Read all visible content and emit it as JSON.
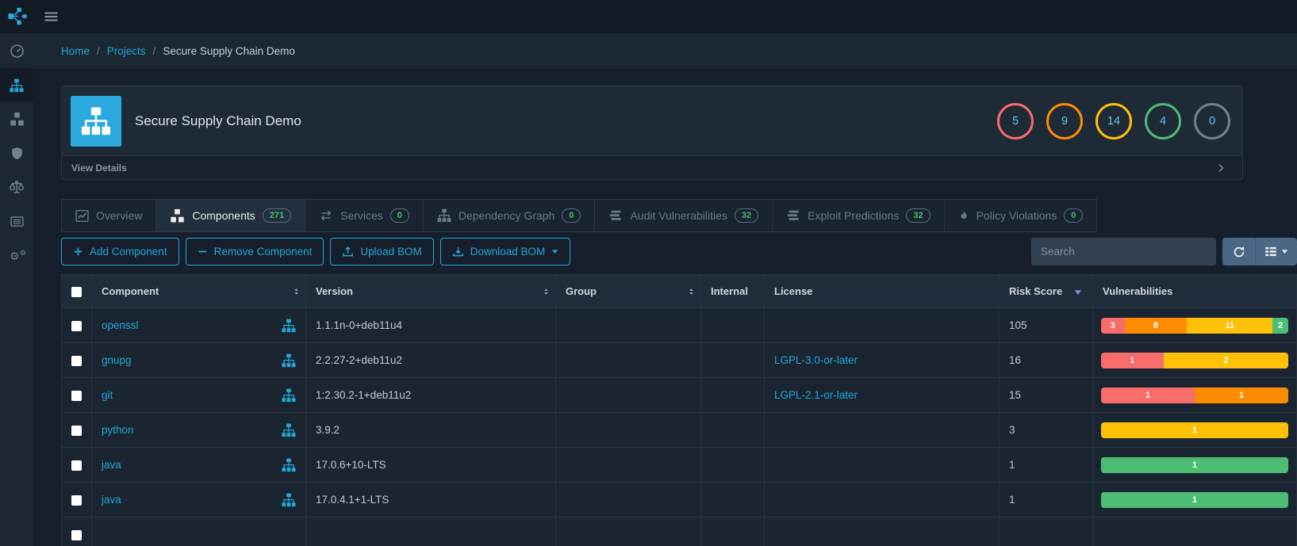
{
  "colors": {
    "accent_blue": "#20a8d8",
    "critical": "#f86c6b",
    "high": "#fd8c00",
    "medium": "#ffc107",
    "low": "#4dbd74",
    "unassigned": "#73818f"
  },
  "topbar": {
    "logo_icon": "dependency-track-logo",
    "menu_icon": "hamburger-icon"
  },
  "breadcrumb": {
    "items": [
      {
        "label": "Home",
        "link": true
      },
      {
        "label": "Projects",
        "link": true
      },
      {
        "label": "Secure Supply Chain Demo",
        "link": false
      }
    ],
    "separator": "/"
  },
  "sidebar": {
    "items": [
      {
        "name": "dashboard",
        "icon": "speedometer-icon",
        "active": false
      },
      {
        "name": "projects",
        "icon": "sitemap-icon",
        "active": true
      },
      {
        "name": "components",
        "icon": "cubes-icon",
        "active": false
      },
      {
        "name": "vulnerabilities",
        "icon": "shield-icon",
        "active": false
      },
      {
        "name": "licenses",
        "icon": "balance-scale-icon",
        "active": false
      },
      {
        "name": "vulnerability-audit",
        "icon": "list-icon",
        "active": false
      },
      {
        "name": "policy-management",
        "icon": "gears-icon",
        "active": false
      }
    ]
  },
  "project": {
    "title": "Secure Supply Chain Demo",
    "icon": "sitemap-icon",
    "severity_badges": [
      {
        "severity": "critical",
        "count": "5"
      },
      {
        "severity": "high",
        "count": "9"
      },
      {
        "severity": "medium",
        "count": "14"
      },
      {
        "severity": "low",
        "count": "4"
      },
      {
        "severity": "unassigned",
        "count": "0"
      }
    ],
    "footer": {
      "label": "View Details",
      "chevron_icon": "chevron-right-icon"
    }
  },
  "tabs": [
    {
      "label": "Overview",
      "icon": "chart-line-icon",
      "badge": null,
      "active": false
    },
    {
      "label": "Components",
      "icon": "cubes-icon",
      "badge": "271",
      "active": true
    },
    {
      "label": "Services",
      "icon": "exchange-icon",
      "badge": "0",
      "active": false
    },
    {
      "label": "Dependency Graph",
      "icon": "sitemap-icon",
      "badge": "0",
      "active": false
    },
    {
      "label": "Audit Vulnerabilities",
      "icon": "stream-icon",
      "badge": "32",
      "active": false
    },
    {
      "label": "Exploit Predictions",
      "icon": "stream-icon",
      "badge": "32",
      "active": false
    },
    {
      "label": "Policy Violations",
      "icon": "fire-icon",
      "badge": "0",
      "active": false
    }
  ],
  "toolbar": {
    "buttons": [
      {
        "label": "Add Component",
        "icon": "plus-icon",
        "caret": false
      },
      {
        "label": "Remove Component",
        "icon": "minus-icon",
        "caret": false
      },
      {
        "label": "Upload BOM",
        "icon": "upload-icon",
        "caret": false
      },
      {
        "label": "Download BOM",
        "icon": "download-icon",
        "caret": true
      }
    ],
    "search": {
      "placeholder": "Search"
    },
    "table_controls": [
      {
        "name": "refresh",
        "icon": "refresh-icon",
        "caret": false
      },
      {
        "name": "columns",
        "icon": "columns-icon",
        "caret": true
      }
    ]
  },
  "table": {
    "columns": [
      {
        "label": "",
        "key": "check",
        "sortable": false,
        "sorted": null
      },
      {
        "label": "Component",
        "key": "component",
        "sortable": true,
        "sorted": null
      },
      {
        "label": "Version",
        "key": "version",
        "sortable": true,
        "sorted": null
      },
      {
        "label": "Group",
        "key": "group",
        "sortable": true,
        "sorted": null
      },
      {
        "label": "Internal",
        "key": "internal",
        "sortable": false,
        "sorted": null
      },
      {
        "label": "License",
        "key": "license",
        "sortable": false,
        "sorted": null
      },
      {
        "label": "Risk Score",
        "key": "risk-score",
        "sortable": false,
        "sorted": "desc"
      },
      {
        "label": "Vulnerabilities",
        "key": "vulnerabilities",
        "sortable": false,
        "sorted": null
      }
    ],
    "rows": [
      {
        "component": "openssl",
        "version": "1.1.1n-0+deb11u4",
        "group": "",
        "internal": "",
        "license": "",
        "license_link": false,
        "risk_score": "105",
        "vulns": [
          {
            "severity": "critical",
            "count": 3
          },
          {
            "severity": "high",
            "count": 8
          },
          {
            "severity": "medium",
            "count": 11
          },
          {
            "severity": "low",
            "count": 2
          }
        ]
      },
      {
        "component": "gnupg",
        "version": "2.2.27-2+deb11u2",
        "group": "",
        "internal": "",
        "license": "LGPL-3.0-or-later",
        "license_link": true,
        "risk_score": "16",
        "vulns": [
          {
            "severity": "critical",
            "count": 1
          },
          {
            "severity": "medium",
            "count": 2
          }
        ]
      },
      {
        "component": "git",
        "version": "1:2.30.2-1+deb11u2",
        "group": "",
        "internal": "",
        "license": "LGPL-2.1-or-later",
        "license_link": true,
        "risk_score": "15",
        "vulns": [
          {
            "severity": "critical",
            "count": 1
          },
          {
            "severity": "high",
            "count": 1
          }
        ]
      },
      {
        "component": "python",
        "version": "3.9.2",
        "group": "",
        "internal": "",
        "license": "",
        "license_link": false,
        "risk_score": "3",
        "vulns": [
          {
            "severity": "medium",
            "count": 1
          }
        ]
      },
      {
        "component": "java",
        "version": "17.0.6+10-LTS",
        "group": "",
        "internal": "",
        "license": "",
        "license_link": false,
        "risk_score": "1",
        "vulns": [
          {
            "severity": "low",
            "count": 1
          }
        ]
      },
      {
        "component": "java",
        "version": "17.0.4.1+1-LTS",
        "group": "",
        "internal": "",
        "license": "",
        "license_link": false,
        "risk_score": "1",
        "vulns": [
          {
            "severity": "low",
            "count": 1
          }
        ]
      }
    ]
  }
}
